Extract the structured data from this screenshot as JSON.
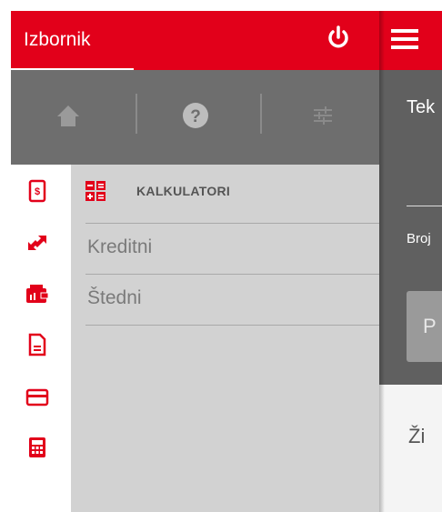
{
  "drawer": {
    "title": "Izbornik",
    "power_icon": "power-icon",
    "toolbar": [
      {
        "icon": "home-icon"
      },
      {
        "icon": "help-icon"
      },
      {
        "icon": "settings-sliders-icon"
      }
    ],
    "side_icons": [
      "mobile-payment-icon",
      "transfer-icon",
      "wallet-icon",
      "document-icon",
      "card-icon",
      "calculator-icon"
    ],
    "section": {
      "icon": "calculator-grid-icon",
      "title": "KALKULATORI",
      "items": [
        "Kreditni",
        "Štedni"
      ]
    }
  },
  "main": {
    "menu_icon": "hamburger-icon",
    "label1": "Tek",
    "label2": "Broj",
    "button_label": "P",
    "label3": "Ži"
  },
  "colors": {
    "brand_red": "#e2001a",
    "toolbar_gray": "#6e6e6e",
    "panel_gray": "#d2d2d2"
  }
}
